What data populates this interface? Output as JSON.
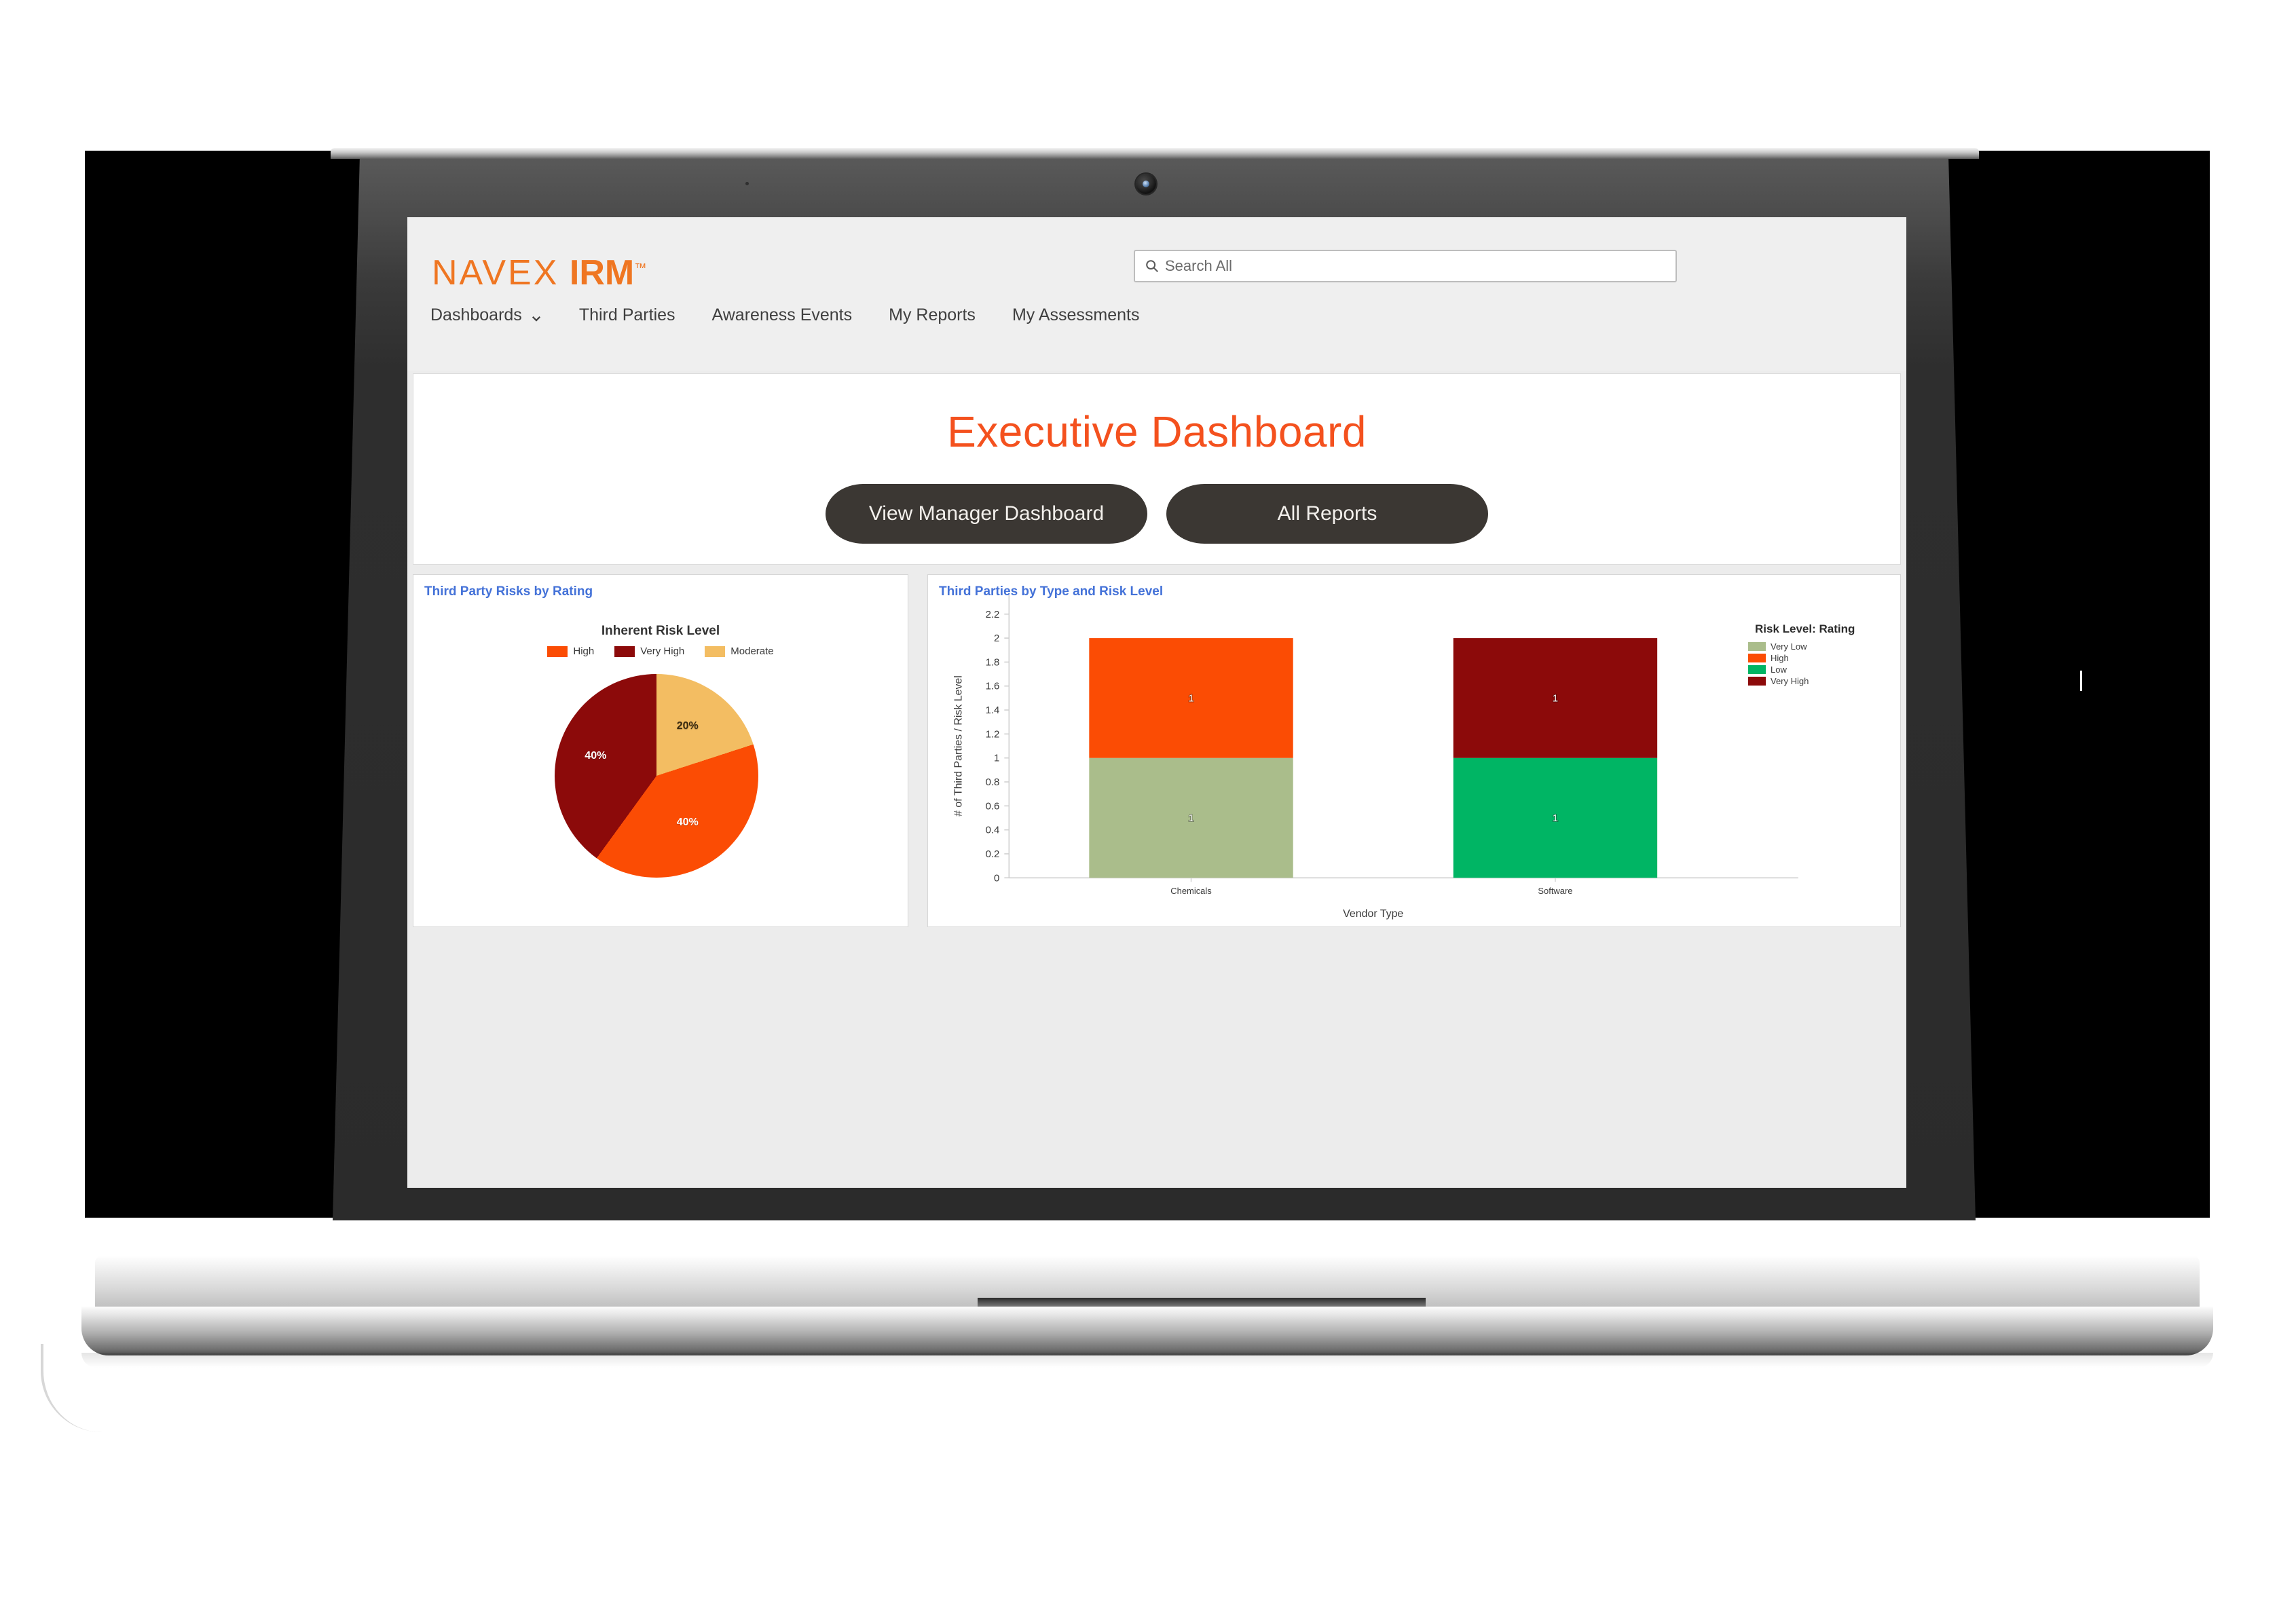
{
  "brand": {
    "name_light": "NAVEX",
    "name_bold": "IRM",
    "trademark": "™"
  },
  "search": {
    "placeholder": "Search All",
    "icon": "search-icon",
    "value": ""
  },
  "nav": {
    "items": [
      {
        "label": "Dashboards",
        "has_caret": true
      },
      {
        "label": "Third Parties",
        "has_caret": false
      },
      {
        "label": "Awareness Events",
        "has_caret": false
      },
      {
        "label": "My Reports",
        "has_caret": false
      },
      {
        "label": "My Assessments",
        "has_caret": false
      }
    ]
  },
  "header": {
    "title": "Executive Dashboard",
    "title_color": "#f4511e"
  },
  "buttons": {
    "manager_dashboard": "View Manager Dashboard",
    "all_reports": "All Reports",
    "fill": "#3b3733"
  },
  "panels": {
    "left_title": "Third Party Risks by Rating",
    "right_title": "Third Parties by Type and Risk Level",
    "title_color": "#4472d8"
  },
  "chart_data": [
    {
      "type": "pie",
      "title": "Third Party Risks by Rating",
      "legend_title": "Inherent Risk Level",
      "legend_position": "top",
      "categories": [
        "High",
        "Very High",
        "Moderate"
      ],
      "values": [
        40,
        40,
        20
      ],
      "value_labels": [
        "40%",
        "40%",
        "20%"
      ],
      "colors": [
        "#fb4c04",
        "#8c0a0a",
        "#f3bd62"
      ],
      "label_colors": [
        "#ffffff",
        "#ffffff",
        "#3a2a10"
      ],
      "slice_order_clockwise_from_top": [
        "Moderate",
        "High",
        "Very High"
      ],
      "unit": "percent"
    },
    {
      "type": "bar",
      "subtype": "stacked",
      "title": "Third Parties by Type and Risk Level",
      "legend_title": "Risk Level: Rating",
      "legend_position": "right",
      "legend_entries": [
        {
          "name": "Very Low",
          "color": "#aabd8b"
        },
        {
          "name": "High",
          "color": "#fb4c04"
        },
        {
          "name": "Low",
          "color": "#00b564"
        },
        {
          "name": "Very High",
          "color": "#8c0a0a"
        }
      ],
      "xlabel": "Vendor Type",
      "ylabel": "# of Third Parties / Risk Level",
      "categories": [
        "Chemicals",
        "Software"
      ],
      "ylim": [
        0,
        2.2
      ],
      "ytick_labels": [
        "0",
        "0.2",
        "0.4",
        "0.6",
        "0.8",
        "1",
        "1.2",
        "1.4",
        "1.6",
        "1.8",
        "2",
        "2.2"
      ],
      "ytick_values": [
        0,
        0.2,
        0.4,
        0.6,
        0.8,
        1,
        1.2,
        1.4,
        1.6,
        1.8,
        2,
        2.2
      ],
      "grid": false,
      "stacks": [
        {
          "category": "Chemicals",
          "segments": [
            {
              "name": "Very Low",
              "value": 1,
              "label": "1",
              "color": "#aabd8b"
            },
            {
              "name": "High",
              "value": 1,
              "label": "1",
              "color": "#fb4c04"
            }
          ],
          "total": 2
        },
        {
          "category": "Software",
          "segments": [
            {
              "name": "Low",
              "value": 1,
              "label": "1",
              "color": "#00b564"
            },
            {
              "name": "Very High",
              "value": 1,
              "label": "1",
              "color": "#8c0a0a"
            }
          ],
          "total": 2
        }
      ]
    }
  ]
}
